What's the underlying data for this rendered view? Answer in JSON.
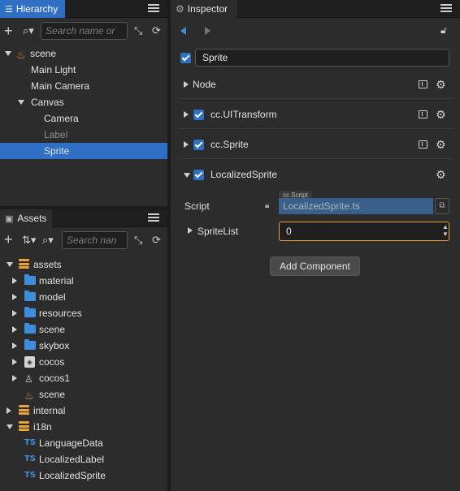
{
  "hierarchy": {
    "tab_label": "Hierarchy",
    "search_placeholder": "Search name or",
    "tree": [
      {
        "label": "scene",
        "depth": 0,
        "arrow": "down",
        "icon": "flame-icon"
      },
      {
        "label": "Main Light",
        "depth": 1
      },
      {
        "label": "Main Camera",
        "depth": 1
      },
      {
        "label": "Canvas",
        "depth": 1,
        "arrow": "down"
      },
      {
        "label": "Camera",
        "depth": 2
      },
      {
        "label": "Label",
        "depth": 2,
        "dim": true
      },
      {
        "label": "Sprite",
        "depth": 2,
        "selected": true
      }
    ]
  },
  "assets": {
    "tab_label": "Assets",
    "search_placeholder": "Search nan",
    "tree": [
      {
        "label": "assets",
        "arrow": "down",
        "icon": "db"
      },
      {
        "label": "material",
        "arrow": "right",
        "icon": "folder"
      },
      {
        "label": "model",
        "arrow": "right",
        "icon": "folder"
      },
      {
        "label": "resources",
        "arrow": "right",
        "icon": "folder"
      },
      {
        "label": "scene",
        "arrow": "right",
        "icon": "folder"
      },
      {
        "label": "skybox",
        "arrow": "right",
        "icon": "folder"
      },
      {
        "label": "cocos",
        "arrow": "right",
        "icon": "box"
      },
      {
        "label": "cocos1",
        "arrow": "right",
        "icon": "person"
      },
      {
        "label": "scene",
        "icon": "flame"
      },
      {
        "label": "internal",
        "arrow": "right",
        "icon": "db"
      },
      {
        "label": "i18n",
        "arrow": "down",
        "icon": "db"
      },
      {
        "label": "LanguageData",
        "icon": "ts"
      },
      {
        "label": "LocalizedLabel",
        "icon": "ts"
      },
      {
        "label": "LocalizedSprite",
        "icon": "ts"
      }
    ]
  },
  "inspector": {
    "tab_label": "Inspector",
    "node_name": "Sprite",
    "components": [
      {
        "label": "Node",
        "checkbox": false,
        "book": true
      },
      {
        "label": "cc.UITransform",
        "checkbox": true,
        "book": true
      },
      {
        "label": "cc.Sprite",
        "checkbox": true,
        "book": true
      },
      {
        "label": "LocalizedSprite",
        "checkbox": true,
        "book": false,
        "expanded": true
      }
    ],
    "script_label": "Script",
    "script_type": "cc.Script",
    "script_value": "LocalizedSprite.ts",
    "spritelist_label": "SpriteList",
    "spritelist_value": "0",
    "add_component_label": "Add Component"
  },
  "colors": {
    "accent": "#2f6fc4",
    "folder": "#3d8fdc",
    "scene": "#e8a23a"
  }
}
